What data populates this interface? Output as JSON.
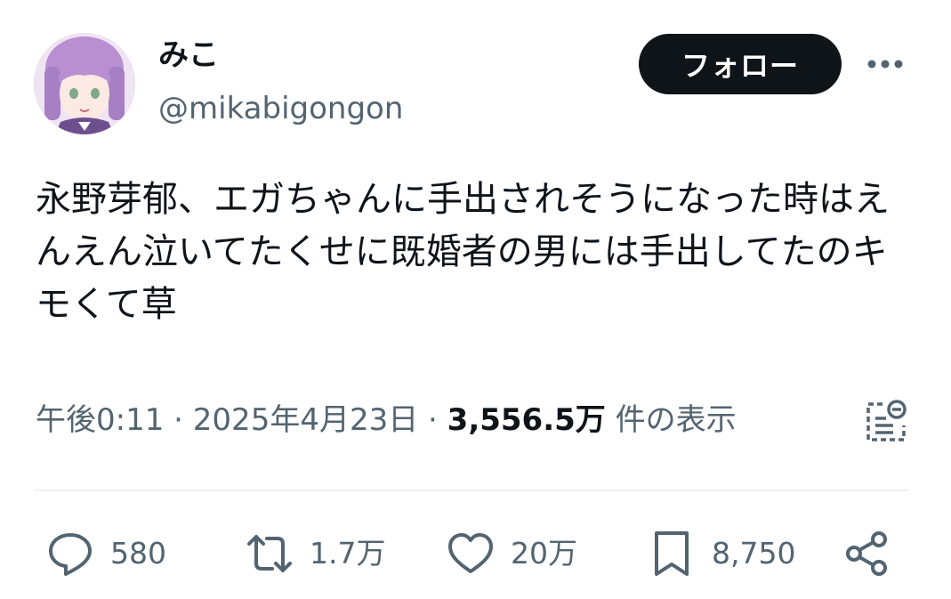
{
  "user": {
    "display_name": "みこ",
    "handle": "@mikabigongon"
  },
  "header": {
    "follow_label": "フォロー",
    "more_icon": "more-horizontal-icon"
  },
  "tweet": {
    "text": "永野芽郁、エガちゃんに手出されそうになった時はえんえん泣いてたくせに既婚者の男には手出してたのキモくて草",
    "time": "午後0:11",
    "separator": "·",
    "date": "2025年4月23日",
    "views_count": "3,556.5万",
    "views_label": "件の表示"
  },
  "actions": {
    "reply": {
      "icon": "reply-icon",
      "count": "580"
    },
    "retweet": {
      "icon": "retweet-icon",
      "count": "1.7万"
    },
    "like": {
      "icon": "heart-icon",
      "count": "20万"
    },
    "bookmark": {
      "icon": "bookmark-icon",
      "count": "8,750"
    },
    "share": {
      "icon": "share-icon"
    }
  },
  "colors": {
    "text_primary": "#0f1419",
    "text_secondary": "#536471",
    "follow_bg": "#0f1419",
    "divider": "#eff3f4"
  }
}
